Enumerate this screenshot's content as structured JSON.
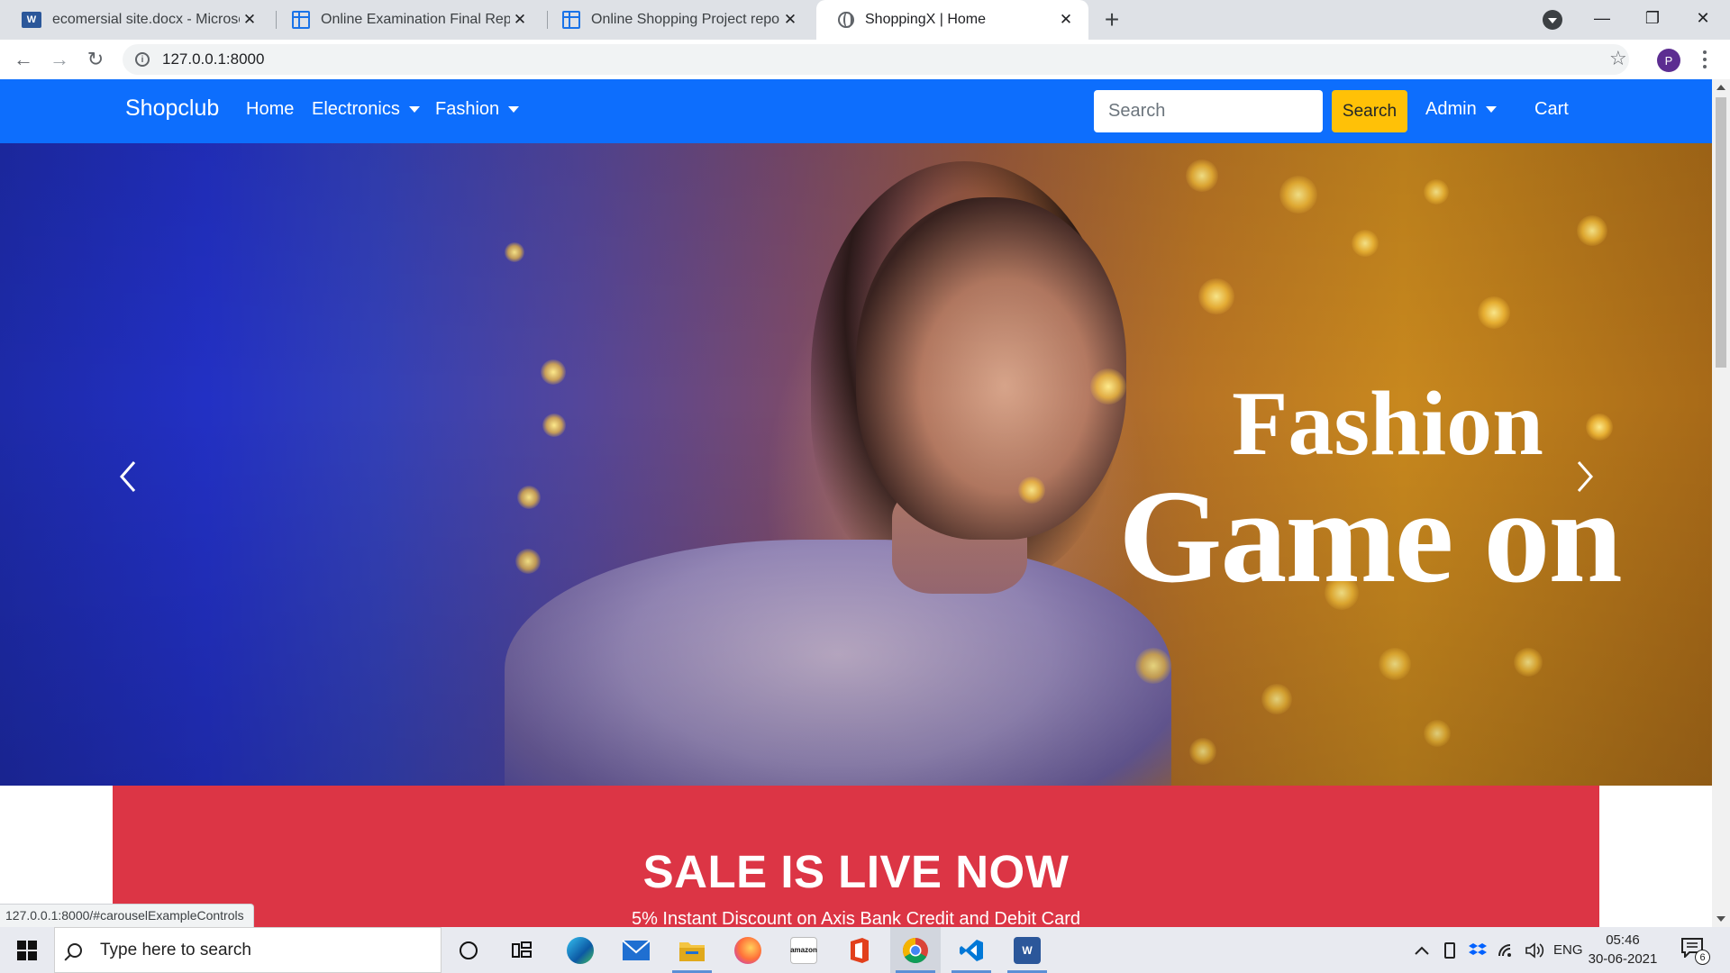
{
  "browser": {
    "tabs": [
      {
        "title": "ecomersial site.docx - Microsoft W",
        "favicon": "word-icon"
      },
      {
        "title": "Online Examination Final Report f",
        "favicon": "doc-icon"
      },
      {
        "title": "Online Shopping Project report in",
        "favicon": "doc-icon"
      },
      {
        "title": "ShoppingX | Home",
        "favicon": "globe-icon",
        "active": true
      }
    ],
    "url": "127.0.0.1:8000",
    "profile_initial": "P",
    "status_url": "127.0.0.1:8000/#carouselExampleControls"
  },
  "site": {
    "brand": "Shopclub",
    "nav": {
      "home": "Home",
      "electronics": "Electronics",
      "fashion": "Fashion",
      "admin": "Admin",
      "cart": "Cart"
    },
    "search": {
      "placeholder": "Search",
      "button": "Search"
    },
    "hero": {
      "caption_line1": "Fashion",
      "caption_line2": "Game on"
    },
    "sale": {
      "title": "SALE IS LIVE NOW",
      "subtitle": "5% Instant Discount on Axis Bank Credit and Debit Card"
    },
    "colors": {
      "navbar": "#0d6efd",
      "search_button": "#ffc107",
      "sale_banner": "#dc3545"
    }
  },
  "taskbar": {
    "search_placeholder": "Type here to search",
    "tray_language": "ENG",
    "time": "05:46",
    "date": "30-06-2021",
    "notification_count": "6",
    "pinned_apps": [
      "cortana-icon",
      "task-view-icon",
      "edge-icon",
      "mail-icon",
      "file-explorer-icon",
      "firefox-icon",
      "amazon-icon",
      "office-icon",
      "chrome-icon",
      "vscode-icon",
      "word-icon"
    ],
    "amazon_label": "amazon"
  }
}
